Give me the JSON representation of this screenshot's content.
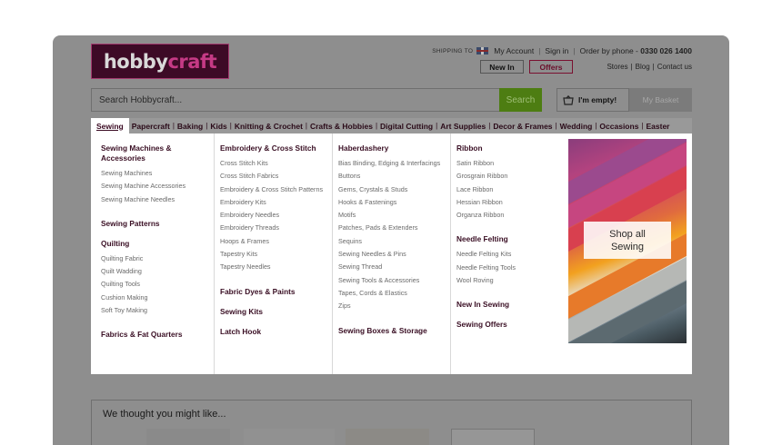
{
  "logo": {
    "part1": "hobby",
    "part2": "craft"
  },
  "header": {
    "shipping_label": "SHIPPING TO",
    "my_account": "My Account",
    "sign_in": "Sign in",
    "order_by_phone_label": "Order by phone - ",
    "phone": "0330 026 1400",
    "sep": "|",
    "new_in": "New In",
    "offers": "Offers",
    "stores": "Stores",
    "blog": "Blog",
    "contact_us": "Contact us"
  },
  "search": {
    "placeholder": "Search Hobbycraft...",
    "button": "Search"
  },
  "basket": {
    "empty_label": "I'm empty!",
    "button": "My Basket"
  },
  "nav": [
    "Sewing",
    "Papercraft",
    "Baking",
    "Kids",
    "Knitting & Crochet",
    "Crafts & Hobbies",
    "Digital Cutting",
    "Art Supplies",
    "Decor & Frames",
    "Wedding",
    "Occasions",
    "Easter"
  ],
  "menu": {
    "col1": {
      "sewing_machines": "Sewing Machines & Accessories",
      "sewing_machines_items": [
        "Sewing Machines",
        "Sewing Machine Accessories",
        "Sewing Machine Needles"
      ],
      "sewing_patterns": "Sewing Patterns",
      "quilting": "Quilting",
      "quilting_items": [
        "Quilting Fabric",
        "Quilt Wadding",
        "Quilting Tools",
        "Cushion Making",
        "Soft Toy Making"
      ],
      "fabrics": "Fabrics & Fat Quarters"
    },
    "col2": {
      "embroidery": "Embroidery & Cross Stitch",
      "embroidery_items": [
        "Cross Stitch Kits",
        "Cross Stitch Fabrics",
        "Embroidery & Cross Stitch Patterns",
        "Embroidery Kits",
        "Embroidery Needles",
        "Embroidery Threads",
        "Hoops & Frames",
        "Tapestry Kits",
        "Tapestry Needles"
      ],
      "fabric_dyes": "Fabric Dyes & Paints",
      "sewing_kits": "Sewing Kits",
      "latch_hook": "Latch Hook"
    },
    "col3": {
      "haberdashery": "Haberdashery",
      "haberdashery_items": [
        "Bias Binding, Edging & Interfacings",
        "Buttons",
        "Gems, Crystals & Studs",
        "Hooks & Fastenings",
        "Motifs",
        "Patches, Pads & Extenders",
        "Sequins",
        "Sewing Needles & Pins",
        "Sewing Thread",
        "Sewing Tools & Accessories",
        "Tapes, Cords & Elastics",
        "Zips"
      ],
      "sewing_boxes": "Sewing Boxes & Storage"
    },
    "col4": {
      "ribbon": "Ribbon",
      "ribbon_items": [
        "Satin Ribbon",
        "Grosgrain Ribbon",
        "Lace Ribbon",
        "Hessian Ribbon",
        "Organza Ribbon"
      ],
      "needle_felting": "Needle Felting",
      "needle_felting_items": [
        "Needle Felting Kits",
        "Needle Felting Tools",
        "Wool Roving"
      ],
      "new_in_sewing": "New In Sewing",
      "sewing_offers": "Sewing Offers"
    },
    "promo": {
      "line1": "Shop all",
      "line2": "Sewing"
    }
  },
  "recommend": {
    "title": "We thought you might like..."
  }
}
